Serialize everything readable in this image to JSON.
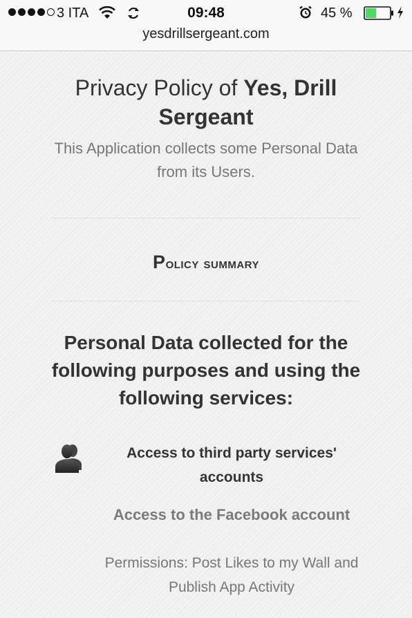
{
  "status_bar": {
    "carrier": "3 ITA",
    "time": "09:48",
    "battery_percent": "45 %",
    "battery_level": 45,
    "battery_color": "#4cd964",
    "icons": [
      "signal-dots",
      "wifi-icon",
      "sync-icon",
      "alarm-icon",
      "battery-icon",
      "charging-icon"
    ]
  },
  "browser": {
    "url": "yesdrillsergeant.com"
  },
  "page": {
    "title_prefix": "Privacy Policy of ",
    "title_brand": "Yes, Drill Sergeant",
    "intro": "This Application collects some Personal Data from its Users.",
    "summary_first": "P",
    "summary_rest": "olicy summary",
    "purposes_heading": "Personal Data collected for the following purposes and using the following services:",
    "service": {
      "icon": "users-icon",
      "title": "Access to third party services' accounts",
      "name": "Access to the Facebook account",
      "permissions": "Permissions: Post Likes to my Wall and Publish App Activity"
    }
  }
}
